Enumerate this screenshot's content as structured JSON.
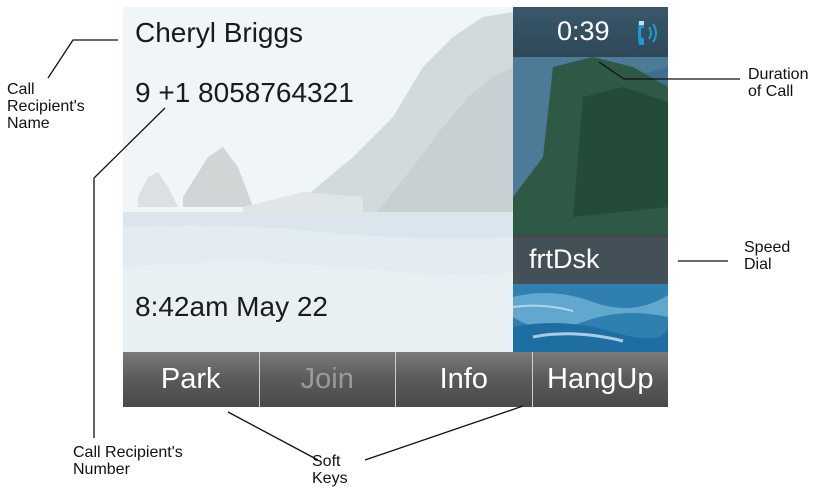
{
  "call": {
    "recipient_name": "Cheryl Briggs",
    "recipient_number": "9  +1 8058764321",
    "datetime": "8:42am May 22",
    "duration": "0:39"
  },
  "icons": {
    "call_status": "handset-icon"
  },
  "speed_dial": {
    "label": "frtDsk"
  },
  "softkeys": [
    {
      "label": "Park",
      "enabled": true
    },
    {
      "label": "Join",
      "enabled": false
    },
    {
      "label": "Info",
      "enabled": true
    },
    {
      "label": "HangUp",
      "enabled": true
    }
  ],
  "callouts": {
    "name": [
      "Call",
      "Recipient's",
      "Name"
    ],
    "number": [
      "Call Recipient's",
      "Number"
    ],
    "duration": [
      "Duration",
      "of Call"
    ],
    "speed_dial": [
      "Speed",
      "Dial"
    ],
    "soft_keys": [
      "Soft",
      "Keys"
    ]
  },
  "colors": {
    "softkey_bar": "#5a5a5a",
    "disabled_softkey_text": "#9a9a9a",
    "handset_icon": "#1e9bd7"
  }
}
